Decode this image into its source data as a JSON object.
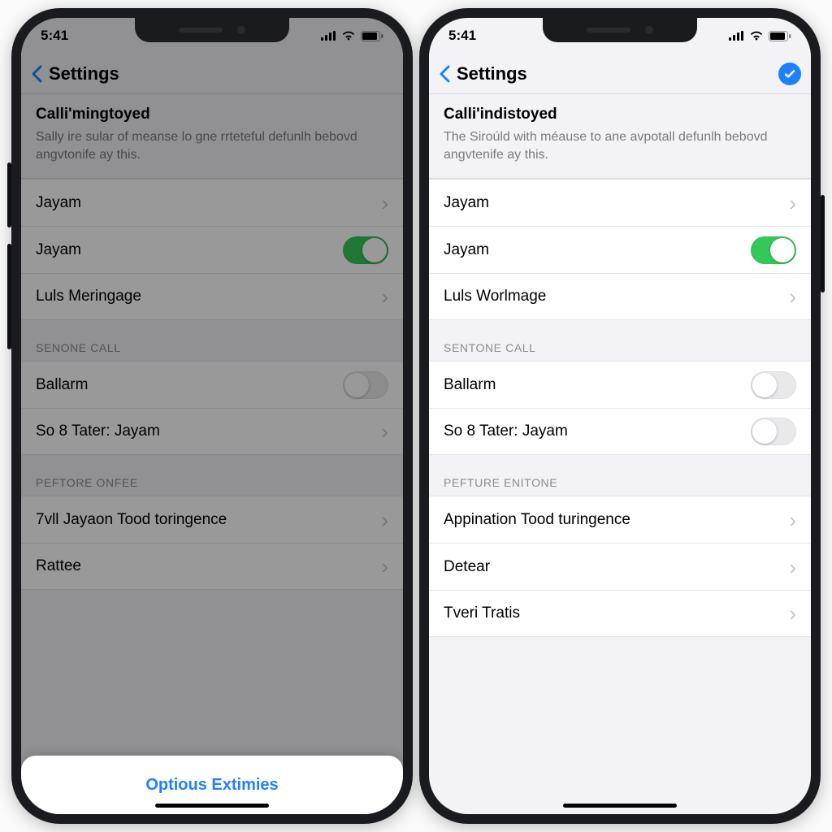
{
  "status": {
    "time": "5:41"
  },
  "colors": {
    "accent": "#1f80ff",
    "toggleOn": "#34c759"
  },
  "left": {
    "title": "Settings",
    "intro": {
      "heading": "Calli'mingtoyed",
      "body": "Sally ire sular of meanse lo gne rrteteful defunlh bebovd angvtonife ay this."
    },
    "rows1": [
      {
        "label": "Jayam",
        "kind": "chevron"
      },
      {
        "label": "Jayam",
        "kind": "toggle",
        "on": true
      },
      {
        "label": "Luls Meringage",
        "kind": "chevron"
      }
    ],
    "header2": "SENONE CALL",
    "rows2": [
      {
        "label": "Ballarm",
        "kind": "toggle",
        "on": false
      },
      {
        "label": "So 8 Tater: Jayam",
        "kind": "chevron"
      }
    ],
    "header3": "PEFTORE ONFEE",
    "rows3": [
      {
        "label": "7vll Jayaon Tood toringence",
        "kind": "chevron"
      },
      {
        "label": "Rattee",
        "kind": "chevron"
      }
    ],
    "sheet": "Optious Extimies"
  },
  "right": {
    "title": "Settings",
    "showCheck": true,
    "intro": {
      "heading": "Calli'indistoyed",
      "body": "The Siroúld with méause to ane avpotall defunlh bebovd angvtenife ay this."
    },
    "rows1": [
      {
        "label": "Jayam",
        "kind": "chevron"
      },
      {
        "label": "Jayam",
        "kind": "toggle",
        "on": true
      },
      {
        "label": "Luls Worlmage",
        "kind": "chevron"
      }
    ],
    "header2": "SENTONE CALL",
    "rows2": [
      {
        "label": "Ballarm",
        "kind": "toggle",
        "on": false
      },
      {
        "label": "So 8 Tater: Jayam",
        "kind": "toggle",
        "on": false
      }
    ],
    "header3": "PEFTURE ENITONE",
    "rows3": [
      {
        "label": "Appination Tood turingence",
        "kind": "chevron"
      },
      {
        "label": "Detear",
        "kind": "chevron"
      },
      {
        "label": "Tveri Tratis",
        "kind": "chevron"
      }
    ]
  }
}
